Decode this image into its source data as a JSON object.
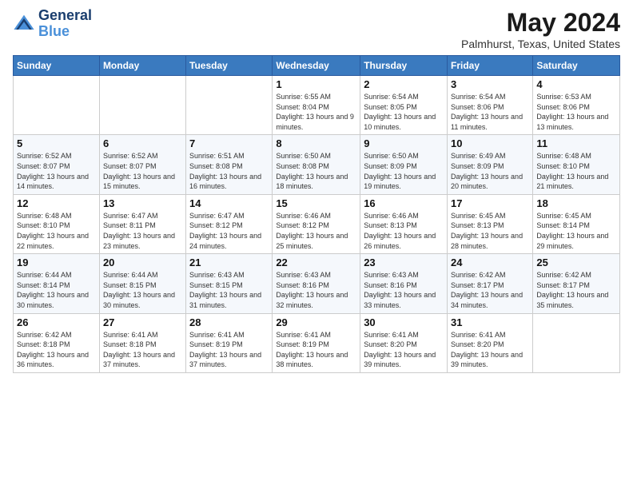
{
  "logo": {
    "line1": "General",
    "line2": "Blue"
  },
  "title": "May 2024",
  "subtitle": "Palmhurst, Texas, United States",
  "days_of_week": [
    "Sunday",
    "Monday",
    "Tuesday",
    "Wednesday",
    "Thursday",
    "Friday",
    "Saturday"
  ],
  "weeks": [
    [
      {
        "day": "",
        "info": ""
      },
      {
        "day": "",
        "info": ""
      },
      {
        "day": "",
        "info": ""
      },
      {
        "day": "1",
        "info": "Sunrise: 6:55 AM\nSunset: 8:04 PM\nDaylight: 13 hours and 9 minutes."
      },
      {
        "day": "2",
        "info": "Sunrise: 6:54 AM\nSunset: 8:05 PM\nDaylight: 13 hours and 10 minutes."
      },
      {
        "day": "3",
        "info": "Sunrise: 6:54 AM\nSunset: 8:06 PM\nDaylight: 13 hours and 11 minutes."
      },
      {
        "day": "4",
        "info": "Sunrise: 6:53 AM\nSunset: 8:06 PM\nDaylight: 13 hours and 13 minutes."
      }
    ],
    [
      {
        "day": "5",
        "info": "Sunrise: 6:52 AM\nSunset: 8:07 PM\nDaylight: 13 hours and 14 minutes."
      },
      {
        "day": "6",
        "info": "Sunrise: 6:52 AM\nSunset: 8:07 PM\nDaylight: 13 hours and 15 minutes."
      },
      {
        "day": "7",
        "info": "Sunrise: 6:51 AM\nSunset: 8:08 PM\nDaylight: 13 hours and 16 minutes."
      },
      {
        "day": "8",
        "info": "Sunrise: 6:50 AM\nSunset: 8:08 PM\nDaylight: 13 hours and 18 minutes."
      },
      {
        "day": "9",
        "info": "Sunrise: 6:50 AM\nSunset: 8:09 PM\nDaylight: 13 hours and 19 minutes."
      },
      {
        "day": "10",
        "info": "Sunrise: 6:49 AM\nSunset: 8:09 PM\nDaylight: 13 hours and 20 minutes."
      },
      {
        "day": "11",
        "info": "Sunrise: 6:48 AM\nSunset: 8:10 PM\nDaylight: 13 hours and 21 minutes."
      }
    ],
    [
      {
        "day": "12",
        "info": "Sunrise: 6:48 AM\nSunset: 8:10 PM\nDaylight: 13 hours and 22 minutes."
      },
      {
        "day": "13",
        "info": "Sunrise: 6:47 AM\nSunset: 8:11 PM\nDaylight: 13 hours and 23 minutes."
      },
      {
        "day": "14",
        "info": "Sunrise: 6:47 AM\nSunset: 8:12 PM\nDaylight: 13 hours and 24 minutes."
      },
      {
        "day": "15",
        "info": "Sunrise: 6:46 AM\nSunset: 8:12 PM\nDaylight: 13 hours and 25 minutes."
      },
      {
        "day": "16",
        "info": "Sunrise: 6:46 AM\nSunset: 8:13 PM\nDaylight: 13 hours and 26 minutes."
      },
      {
        "day": "17",
        "info": "Sunrise: 6:45 AM\nSunset: 8:13 PM\nDaylight: 13 hours and 28 minutes."
      },
      {
        "day": "18",
        "info": "Sunrise: 6:45 AM\nSunset: 8:14 PM\nDaylight: 13 hours and 29 minutes."
      }
    ],
    [
      {
        "day": "19",
        "info": "Sunrise: 6:44 AM\nSunset: 8:14 PM\nDaylight: 13 hours and 30 minutes."
      },
      {
        "day": "20",
        "info": "Sunrise: 6:44 AM\nSunset: 8:15 PM\nDaylight: 13 hours and 30 minutes."
      },
      {
        "day": "21",
        "info": "Sunrise: 6:43 AM\nSunset: 8:15 PM\nDaylight: 13 hours and 31 minutes."
      },
      {
        "day": "22",
        "info": "Sunrise: 6:43 AM\nSunset: 8:16 PM\nDaylight: 13 hours and 32 minutes."
      },
      {
        "day": "23",
        "info": "Sunrise: 6:43 AM\nSunset: 8:16 PM\nDaylight: 13 hours and 33 minutes."
      },
      {
        "day": "24",
        "info": "Sunrise: 6:42 AM\nSunset: 8:17 PM\nDaylight: 13 hours and 34 minutes."
      },
      {
        "day": "25",
        "info": "Sunrise: 6:42 AM\nSunset: 8:17 PM\nDaylight: 13 hours and 35 minutes."
      }
    ],
    [
      {
        "day": "26",
        "info": "Sunrise: 6:42 AM\nSunset: 8:18 PM\nDaylight: 13 hours and 36 minutes."
      },
      {
        "day": "27",
        "info": "Sunrise: 6:41 AM\nSunset: 8:18 PM\nDaylight: 13 hours and 37 minutes."
      },
      {
        "day": "28",
        "info": "Sunrise: 6:41 AM\nSunset: 8:19 PM\nDaylight: 13 hours and 37 minutes."
      },
      {
        "day": "29",
        "info": "Sunrise: 6:41 AM\nSunset: 8:19 PM\nDaylight: 13 hours and 38 minutes."
      },
      {
        "day": "30",
        "info": "Sunrise: 6:41 AM\nSunset: 8:20 PM\nDaylight: 13 hours and 39 minutes."
      },
      {
        "day": "31",
        "info": "Sunrise: 6:41 AM\nSunset: 8:20 PM\nDaylight: 13 hours and 39 minutes."
      },
      {
        "day": "",
        "info": ""
      }
    ]
  ]
}
